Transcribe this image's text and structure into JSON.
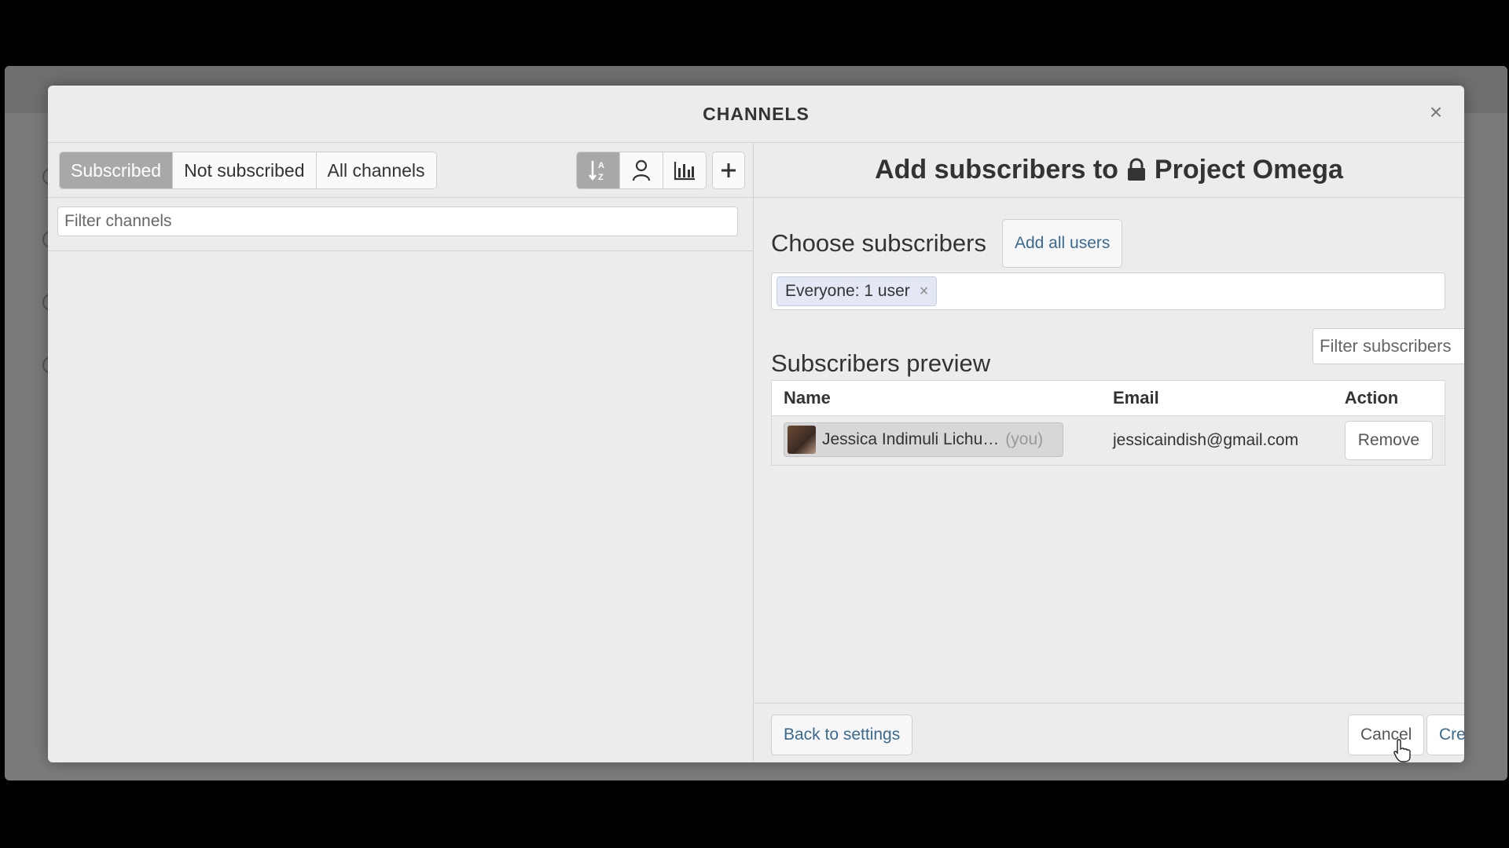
{
  "modal": {
    "title": "CHANNELS",
    "close_label": "×"
  },
  "left": {
    "tabs": [
      "Subscribed",
      "Not subscribed",
      "All channels"
    ],
    "active_tab": "Subscribed",
    "sort_icons": [
      "sort-alpha-icon",
      "user-icon",
      "bar-chart-icon"
    ],
    "add_icon": "plus-icon",
    "filter_placeholder": "Filter channels"
  },
  "right": {
    "header_prefix": "Add subscribers to",
    "channel_name": "Project Omega",
    "channel_icon": "lock-icon",
    "choose_title": "Choose subscribers",
    "add_all_label": "Add all users",
    "pill_label": "Everyone: 1 user",
    "preview_title": "Subscribers preview",
    "filter_subs_placeholder": "Filter subscribers",
    "table": {
      "columns": [
        "Name",
        "Email",
        "Action"
      ],
      "rows": [
        {
          "name": "Jessica Indimuli Lichu…",
          "you": "(you)",
          "email": "jessicaindish@gmail.com",
          "action": "Remove"
        }
      ]
    },
    "back_label": "Back to settings",
    "cancel_label": "Cancel",
    "create_label": "Create"
  },
  "colors": {
    "modal_bg": "#ececec",
    "active_tab": "#a8a8a8",
    "link": "#3a6a8f"
  }
}
